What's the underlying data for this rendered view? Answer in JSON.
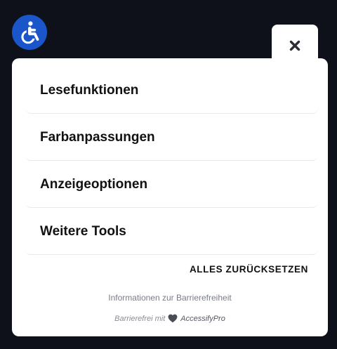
{
  "accessibility_button": {
    "icon": "wheelchair-icon"
  },
  "close_button": {
    "icon": "close-icon"
  },
  "menu": {
    "items": [
      {
        "label": "Lesefunktionen"
      },
      {
        "label": "Farbanpassungen"
      },
      {
        "label": "Anzeigeoptionen"
      },
      {
        "label": "Weitere Tools"
      }
    ]
  },
  "reset_label": "ALLES ZURÜCKSETZEN",
  "info_link": "Informationen zur Barrierefreiheit",
  "footer": {
    "prefix": "Barrierefrei mit",
    "brand": "AccessifyPro",
    "icon": "heart-icon"
  },
  "colors": {
    "background": "#0e1119",
    "accent": "#1a56c9",
    "panel": "#ffffff",
    "divider": "#e8e9ec"
  }
}
